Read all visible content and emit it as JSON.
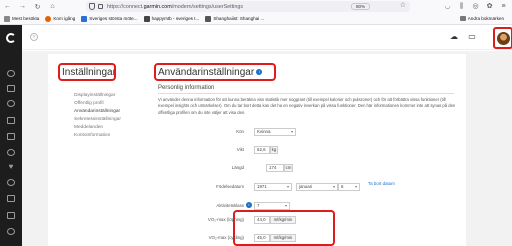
{
  "browser": {
    "url_prefix": "https://connect.",
    "url_host": "garmin.com",
    "url_path": "/modern/settings/userSettings",
    "zoom": "80%",
    "bookmarks": [
      {
        "label": "Mest besökta",
        "color": "#888888"
      },
      {
        "label": "Kom igång",
        "color": "#e66000"
      },
      {
        "label": "Sveriges största möte...",
        "color": "#2a6fd6"
      },
      {
        "label": "happymtb - sveriges t...",
        "color": "#444444"
      },
      {
        "label": "Shanghaiist: Shanghai ...",
        "color": "#555555"
      }
    ],
    "bookmarks_right": "Andra bokmärken"
  },
  "settings": {
    "page_title": "Inställningar",
    "nav": [
      "Displayinställningar",
      "Offentlig profil",
      "Användarinställningar",
      "Sekretessinställningar",
      "Meddelanden",
      "Kontoinformation"
    ],
    "section_title": "Användarinställningar",
    "info_glyph": "i",
    "subheading": "Personlig information",
    "description": "Vi använder denna information för att kunna beräkna viss statistik mer noggrant (till exempel kalorier och pulszoner) och för att förbättra vissa funktioner (till exempel insights och utmärkelser). Om du tar bort detta kan det ha en negativ inverkan på vissa funktioner. Den här informationen kommer inte att synas på den offentliga profilen om du inte väljer att visa den."
  },
  "form": {
    "gender_label": "Kön",
    "gender_value": "Kvinna",
    "weight_label": "Vikt",
    "weight_value": "62,6",
    "weight_unit": "kg",
    "height_label": "Längd",
    "height_value": "174",
    "height_unit": "cm",
    "birth_label": "Födelsedatum",
    "birth_year": "1971",
    "birth_month": "januari",
    "birth_day": "6",
    "remove_date": "Ta bort datum",
    "activity_label": "Aktivitetsklass",
    "activity_value": "7",
    "vo2_run_label": "VO₂-max (löpning)",
    "vo2_run_value": "44,0",
    "vo2_run_unit": "ml/kg/min",
    "vo2_cycle_label": "VO₂-max (cykling)",
    "vo2_cycle_value": "45,0",
    "vo2_cycle_unit": "ml/kg/min"
  },
  "colors": {
    "highlight": "#e01b1b",
    "accent": "#1a6fc9",
    "sidebar": "#1d1d1d"
  }
}
